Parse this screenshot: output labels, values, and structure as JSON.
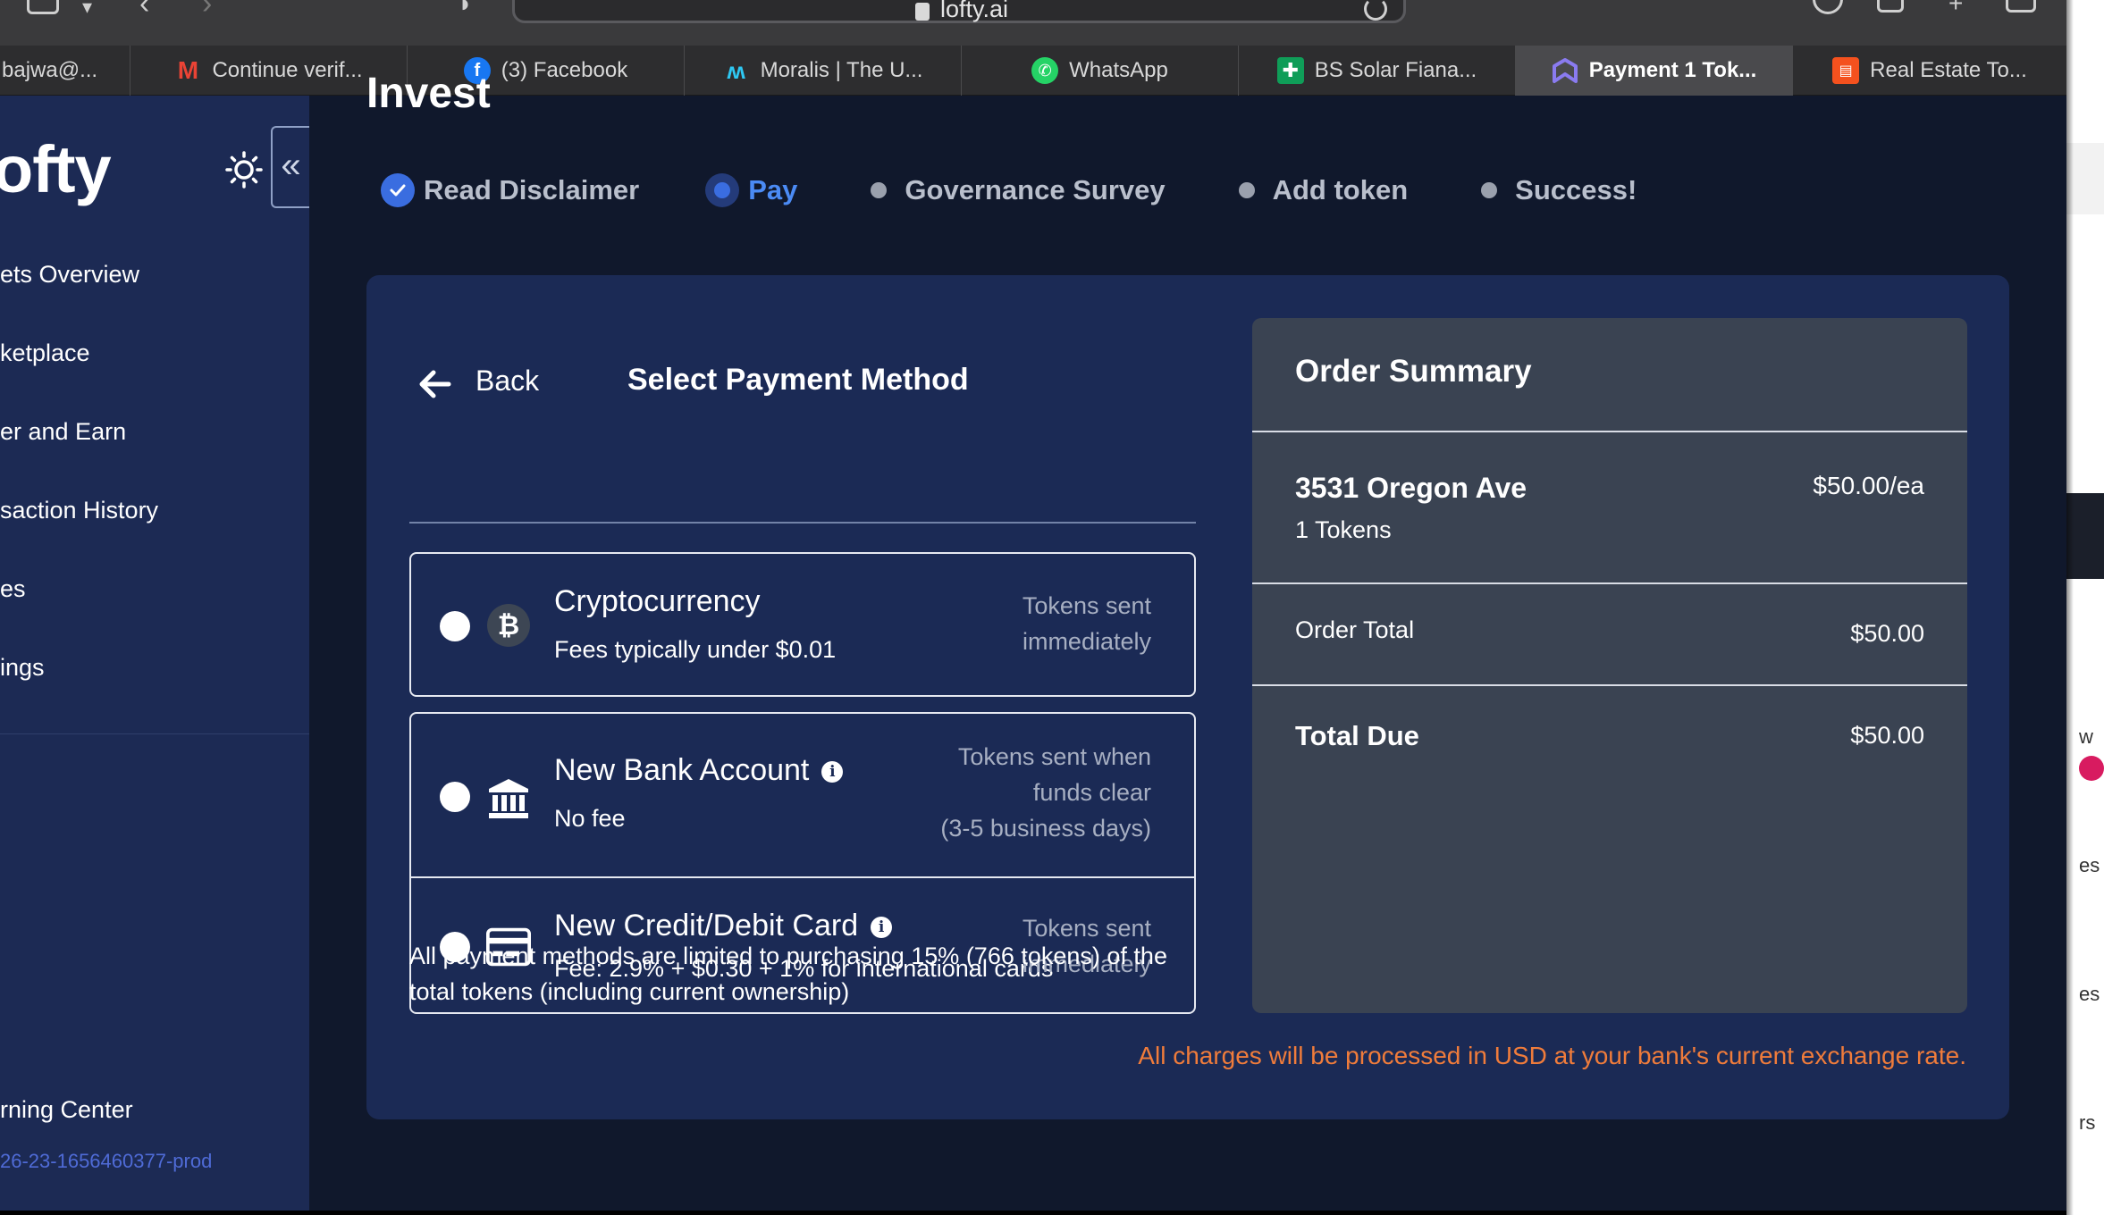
{
  "browser": {
    "url": "lofty.ai",
    "tabs": [
      {
        "label": "bajwa@...",
        "icon": "mail-icon",
        "active": false
      },
      {
        "label": "Continue verif...",
        "icon": "gmail-icon",
        "active": false
      },
      {
        "label": "(3) Facebook",
        "icon": "facebook-icon",
        "active": false
      },
      {
        "label": "Moralis | The U...",
        "icon": "moralis-icon",
        "active": false
      },
      {
        "label": "WhatsApp",
        "icon": "whatsapp-icon",
        "active": false
      },
      {
        "label": "BS Solar Fiana...",
        "icon": "sheets-icon",
        "active": false
      },
      {
        "label": "Payment 1 Tok...",
        "icon": "lofty-icon",
        "active": true
      },
      {
        "label": "Real Estate To...",
        "icon": "slides-icon",
        "active": false
      }
    ]
  },
  "sidebar": {
    "logo": "ofty",
    "items": [
      {
        "label": "ets Overview"
      },
      {
        "label": "ketplace"
      },
      {
        "label": "er and Earn"
      },
      {
        "label": "saction History"
      },
      {
        "label": "es"
      },
      {
        "label": "ings"
      }
    ],
    "learning": "rning Center",
    "version": "26-23-1656460377-prod"
  },
  "page": {
    "heading": "Invest"
  },
  "steps": [
    {
      "label": "Read Disclaimer",
      "state": "done"
    },
    {
      "label": "Pay",
      "state": "active"
    },
    {
      "label": "Governance Survey",
      "state": "pending"
    },
    {
      "label": "Add token",
      "state": "pending"
    },
    {
      "label": "Success!",
      "state": "pending"
    }
  ],
  "payment": {
    "back_label": "Back",
    "title": "Select Payment Method",
    "methods": [
      {
        "name": "Cryptocurrency",
        "fee": "Fees typically under $0.01",
        "sent": [
          "Tokens sent",
          "immediately"
        ],
        "icon": "bitcoin-icon",
        "has_info": false
      },
      {
        "name": "New Bank Account",
        "fee": "No fee",
        "sent": [
          "Tokens sent when",
          "funds clear",
          "(3-5 business days)"
        ],
        "icon": "bank-icon",
        "has_info": true
      },
      {
        "name": "New Credit/Debit Card",
        "fee": "Fee: 2.9% + $0.30 + 1% for international cards",
        "sent": [
          "Tokens sent",
          "immediately"
        ],
        "icon": "credit-card-icon",
        "has_info": true
      }
    ],
    "limit_note": "All payment methods are limited to purchasing 15% (766 tokens) of the total tokens (including current ownership)"
  },
  "summary": {
    "title": "Order Summary",
    "property": "3531 Oregon Ave",
    "tokens": "1 Tokens",
    "price_each": "$50.00/ea",
    "order_total_label": "Order Total",
    "order_total_value": "$50.00",
    "total_due_label": "Total Due",
    "total_due_value": "$50.00"
  },
  "usd_note": "All charges will be processed in USD at your bank's current exchange rate.",
  "colors": {
    "accent": "#3a6de0",
    "card_bg": "#1b2a55",
    "summary_bg": "#3a4352",
    "warning": "#f07c3b"
  }
}
